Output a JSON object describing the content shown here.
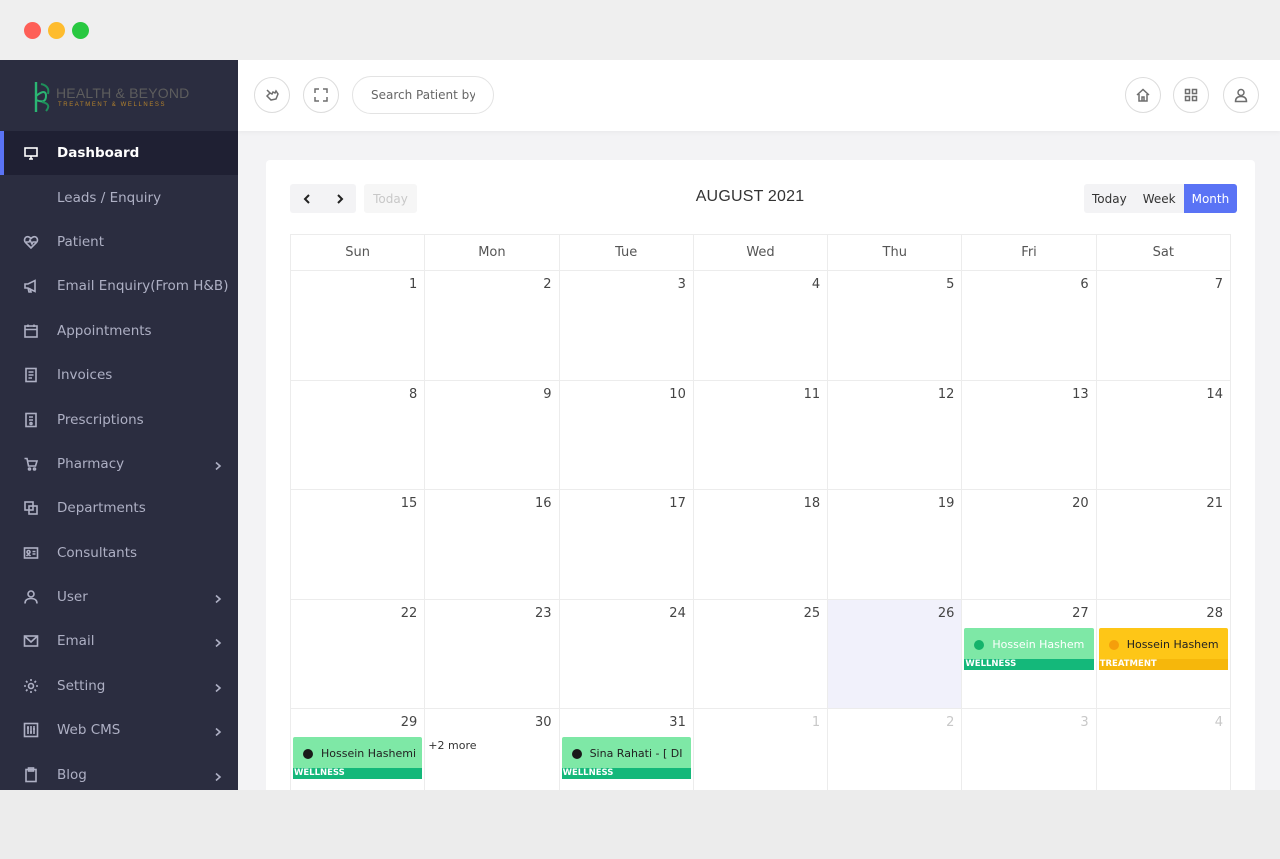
{
  "brand": {
    "name": "HEALTH & BEYOND",
    "tagline": "TREATMENT & WELLNESS"
  },
  "sidebar": {
    "items": [
      {
        "label": "Dashboard",
        "icon": "monitor-icon",
        "active": true,
        "chevron": false
      },
      {
        "label": "Leads / Enquiry",
        "icon": "",
        "active": false,
        "chevron": false
      },
      {
        "label": "Patient",
        "icon": "heart-pulse-icon",
        "active": false,
        "chevron": false
      },
      {
        "label": "Email Enquiry(From H&B)",
        "icon": "megaphone-icon",
        "active": false,
        "chevron": false
      },
      {
        "label": "Appointments",
        "icon": "calendar-icon",
        "active": false,
        "chevron": false
      },
      {
        "label": "Invoices",
        "icon": "invoice-icon",
        "active": false,
        "chevron": false
      },
      {
        "label": "Prescriptions",
        "icon": "prescription-icon",
        "active": false,
        "chevron": false
      },
      {
        "label": "Pharmacy",
        "icon": "cart-icon",
        "active": false,
        "chevron": true
      },
      {
        "label": "Departments",
        "icon": "departments-icon",
        "active": false,
        "chevron": false
      },
      {
        "label": "Consultants",
        "icon": "id-card-icon",
        "active": false,
        "chevron": false
      },
      {
        "label": "User",
        "icon": "user-icon",
        "active": false,
        "chevron": true
      },
      {
        "label": "Email",
        "icon": "envelope-icon",
        "active": false,
        "chevron": true
      },
      {
        "label": "Setting",
        "icon": "gear-icon",
        "active": false,
        "chevron": true
      },
      {
        "label": "Web CMS",
        "icon": "sliders-icon",
        "active": false,
        "chevron": true
      },
      {
        "label": "Blog",
        "icon": "clipboard-icon",
        "active": false,
        "chevron": true
      }
    ]
  },
  "header": {
    "search_placeholder": "Search Patient by",
    "icons": [
      "hand-pointer-icon",
      "fullscreen-icon",
      "home-icon",
      "apps-grid-icon",
      "user-icon"
    ]
  },
  "calendar": {
    "title": "AUGUST 2021",
    "today_label": "Today",
    "views": [
      {
        "label": "Today",
        "active": false
      },
      {
        "label": "Week",
        "active": false
      },
      {
        "label": "Month",
        "active": true
      }
    ],
    "weekdays": [
      "Sun",
      "Mon",
      "Tue",
      "Wed",
      "Thu",
      "Fri",
      "Sat"
    ],
    "weeks": [
      [
        {
          "day": "1"
        },
        {
          "day": "2"
        },
        {
          "day": "3"
        },
        {
          "day": "4"
        },
        {
          "day": "5"
        },
        {
          "day": "6"
        },
        {
          "day": "7"
        }
      ],
      [
        {
          "day": "8"
        },
        {
          "day": "9"
        },
        {
          "day": "10"
        },
        {
          "day": "11"
        },
        {
          "day": "12"
        },
        {
          "day": "13"
        },
        {
          "day": "14"
        }
      ],
      [
        {
          "day": "15"
        },
        {
          "day": "16"
        },
        {
          "day": "17"
        },
        {
          "day": "18"
        },
        {
          "day": "19"
        },
        {
          "day": "20"
        },
        {
          "day": "21"
        }
      ],
      [
        {
          "day": "22"
        },
        {
          "day": "23"
        },
        {
          "day": "24"
        },
        {
          "day": "25"
        },
        {
          "day": "26",
          "today": true
        },
        {
          "day": "27",
          "event": {
            "title": "Hossein Hashem",
            "tag": "WELLNESS",
            "color": "green",
            "alt": true
          }
        },
        {
          "day": "28",
          "event": {
            "title": "Hossein Hashem",
            "tag": "TREATMENT",
            "color": "yellow"
          }
        }
      ],
      [
        {
          "day": "29",
          "event": {
            "title": "Hossein Hashemi",
            "tag": "WELLNESS",
            "color": "green"
          }
        },
        {
          "day": "30",
          "more": "+2 more"
        },
        {
          "day": "31",
          "event": {
            "title": "Sina Rahati - [ DI",
            "tag": "WELLNESS",
            "color": "green"
          }
        },
        {
          "day": "1",
          "other": true
        },
        {
          "day": "2",
          "other": true
        },
        {
          "day": "3",
          "other": true
        },
        {
          "day": "4",
          "other": true
        }
      ]
    ]
  },
  "colors": {
    "accent": "#5a73f5",
    "sidebar_bg": "#2b2d40",
    "event_green": "#7ee8a6",
    "event_yellow": "#fec617"
  }
}
